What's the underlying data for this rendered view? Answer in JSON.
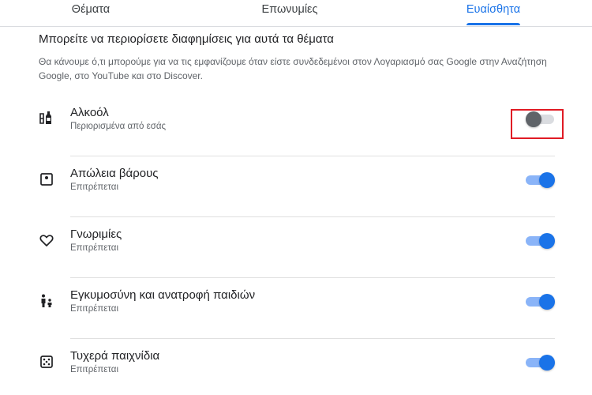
{
  "tabs": [
    {
      "label": "Θέματα",
      "active": false
    },
    {
      "label": "Επωνυμίες",
      "active": false
    },
    {
      "label": "Ευαίσθητα",
      "active": true
    }
  ],
  "accent_color": "#1a73e8",
  "heading": "Μπορείτε να περιορίσετε διαφημίσεις για αυτά τα θέματα",
  "description": "Θα κάνουμε ό,τι μπορούμε για να τις εμφανίζουμε όταν είστε συνδεδεμένοι στον Λογαριασμό σας Google στην Αναζήτηση Google, στο YouTube και στο Discover.",
  "items": [
    {
      "title": "Αλκοόλ",
      "status": "Περιορισμένα από εσάς",
      "icon": "alcohol-icon",
      "enabled": false
    },
    {
      "title": "Απώλεια βάρους",
      "status": "Επιτρέπεται",
      "icon": "scale-icon",
      "enabled": true
    },
    {
      "title": "Γνωριμίες",
      "status": "Επιτρέπεται",
      "icon": "heart-icon",
      "enabled": true
    },
    {
      "title": "Εγκυμοσύνη και ανατροφή παιδιών",
      "status": "Επιτρέπεται",
      "icon": "family-icon",
      "enabled": true
    },
    {
      "title": "Τυχερά παιχνίδια",
      "status": "Επιτρέπεται",
      "icon": "dice-icon",
      "enabled": true
    }
  ]
}
